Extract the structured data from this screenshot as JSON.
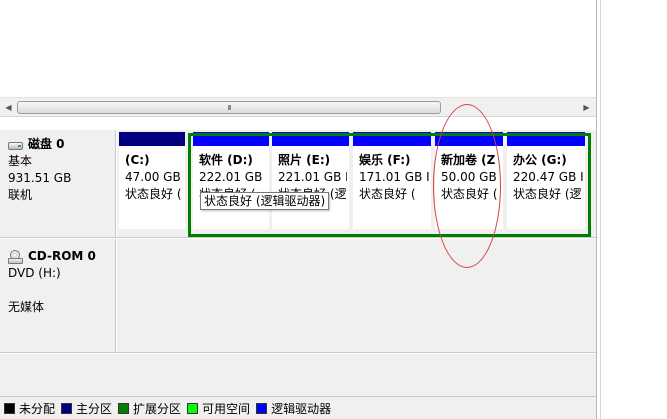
{
  "scrollbar": {
    "grip": "III"
  },
  "disks": [
    {
      "name": "磁盘 0",
      "type": "基本",
      "size": "931.51 GB",
      "status": "联机",
      "partitions": [
        {
          "name": "(C:)",
          "size": "47.00 GB",
          "status": "状态良好 (",
          "kind": "primary"
        },
        {
          "name": "软件 (D:)",
          "size": "222.01 GB",
          "status": "状态良好 (",
          "kind": "logical"
        },
        {
          "name": "照片 (E:)",
          "size": "221.01 GB I",
          "status": "状态良好 (逻",
          "kind": "logical"
        },
        {
          "name": "娱乐 (F:)",
          "size": "171.01 GB I",
          "status": "状态良好 (",
          "kind": "logical"
        },
        {
          "name": "新加卷 (Z",
          "size": "50.00 GB",
          "status": "状态良好 (",
          "kind": "logical"
        },
        {
          "name": "办公 (G:)",
          "size": "220.47 GB I",
          "status": "状态良好 (逻",
          "kind": "logical"
        }
      ]
    },
    {
      "name": "CD-ROM 0",
      "type": "DVD (H:)",
      "size": "",
      "status": "无媒体"
    }
  ],
  "tooltip": "状态良好 (逻辑驱动器)",
  "legend": [
    {
      "label": "未分配",
      "color": "#000000"
    },
    {
      "label": "主分区",
      "color": "#00007f"
    },
    {
      "label": "扩展分区",
      "color": "#007f00"
    },
    {
      "label": "可用空间",
      "color": "#00ff00"
    },
    {
      "label": "逻辑驱动器",
      "color": "#0000ff"
    }
  ]
}
